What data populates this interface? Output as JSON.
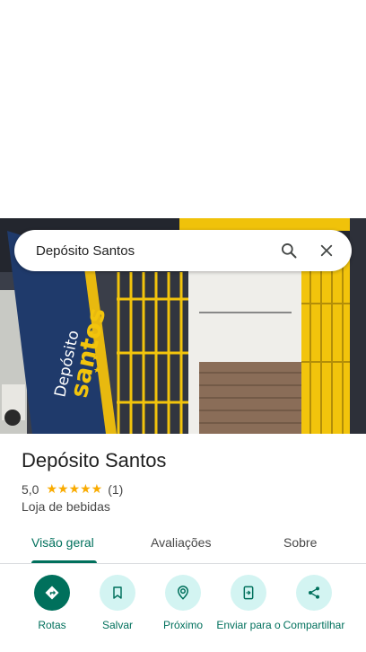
{
  "search": {
    "query": "Depósito Santos"
  },
  "hero": {
    "sign_line1": "Depósito",
    "sign_line2": "santos"
  },
  "place": {
    "title": "Depósito Santos",
    "rating": "5,0",
    "stars": "★★★★★",
    "review_count": "(1)",
    "category": "Loja de bebidas"
  },
  "tabs": [
    {
      "label": "Visão geral",
      "active": true
    },
    {
      "label": "Avaliações",
      "active": false
    },
    {
      "label": "Sobre",
      "active": false
    }
  ],
  "actions": [
    {
      "label": "Rotas",
      "icon": "directions-icon"
    },
    {
      "label": "Salvar",
      "icon": "bookmark-icon"
    },
    {
      "label": "Próximo",
      "icon": "nearby-icon"
    },
    {
      "label": "Enviar para o",
      "icon": "send-to-phone-icon"
    },
    {
      "label": "Compartilhar",
      "icon": "share-icon"
    }
  ],
  "colors": {
    "accent": "#00705c",
    "action_bg": "#d3f4f2",
    "star": "#f9ab00"
  }
}
